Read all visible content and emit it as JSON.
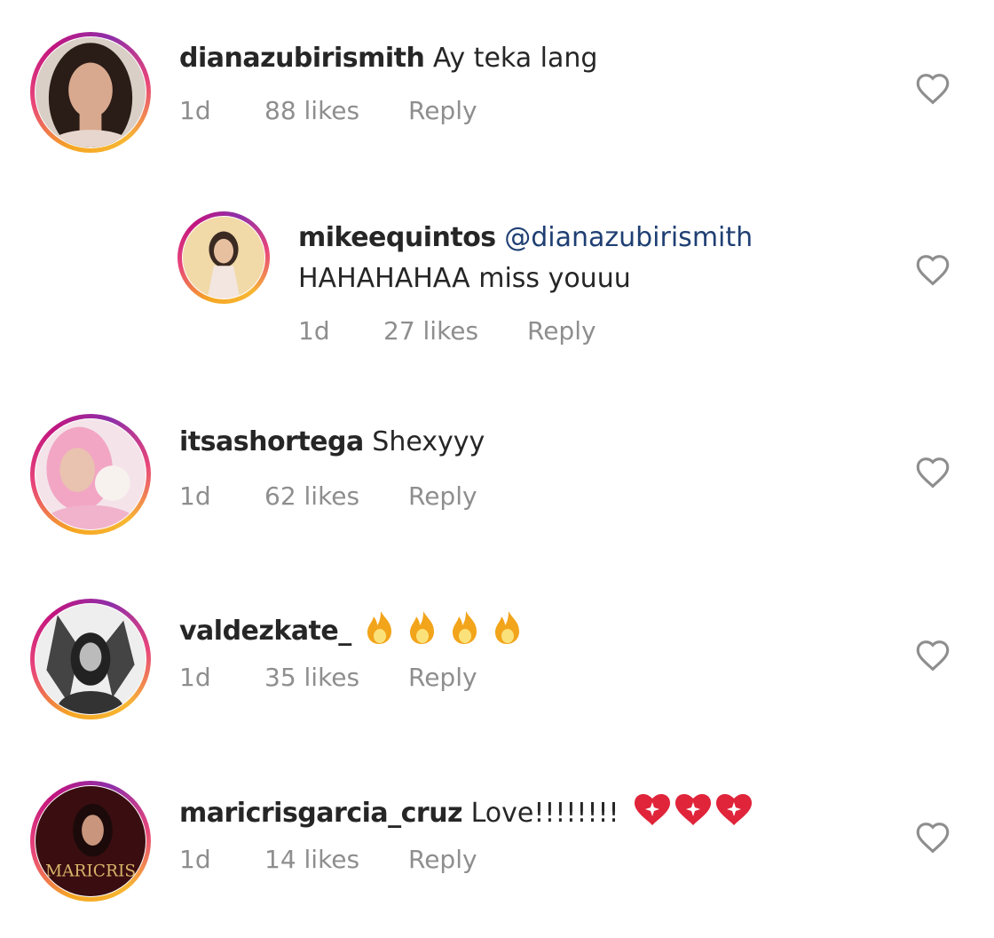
{
  "comments": [
    {
      "username": "dianazubirismith",
      "text": "Ay teka lang",
      "age": "1d",
      "likes": "88 likes",
      "reply": "Reply"
    },
    {
      "username": "mikeequintos",
      "mention": "@dianazubirismith",
      "text": "HAHAHAHAA miss youuu",
      "age": "1d",
      "likes": "27 likes",
      "reply": "Reply"
    },
    {
      "username": "itsashortega",
      "text": "Shexyyy",
      "age": "1d",
      "likes": "62 likes",
      "reply": "Reply"
    },
    {
      "username": "valdezkate_",
      "text": "",
      "emoji": "fire-emoji x4",
      "age": "1d",
      "likes": "35 likes",
      "reply": "Reply"
    },
    {
      "username": "maricrisgarcia_cruz",
      "text": "Love!!!!!!!!",
      "emoji": "sparkling-heart-emoji x3",
      "avatar_text": "MARICRIS",
      "age": "1d",
      "likes": "14 likes",
      "reply": "Reply"
    }
  ],
  "colors": {
    "ring_start": "#f5a623",
    "ring_end": "#c2157f",
    "mention": "#1f3f73",
    "meta": "#8e8e8e"
  }
}
